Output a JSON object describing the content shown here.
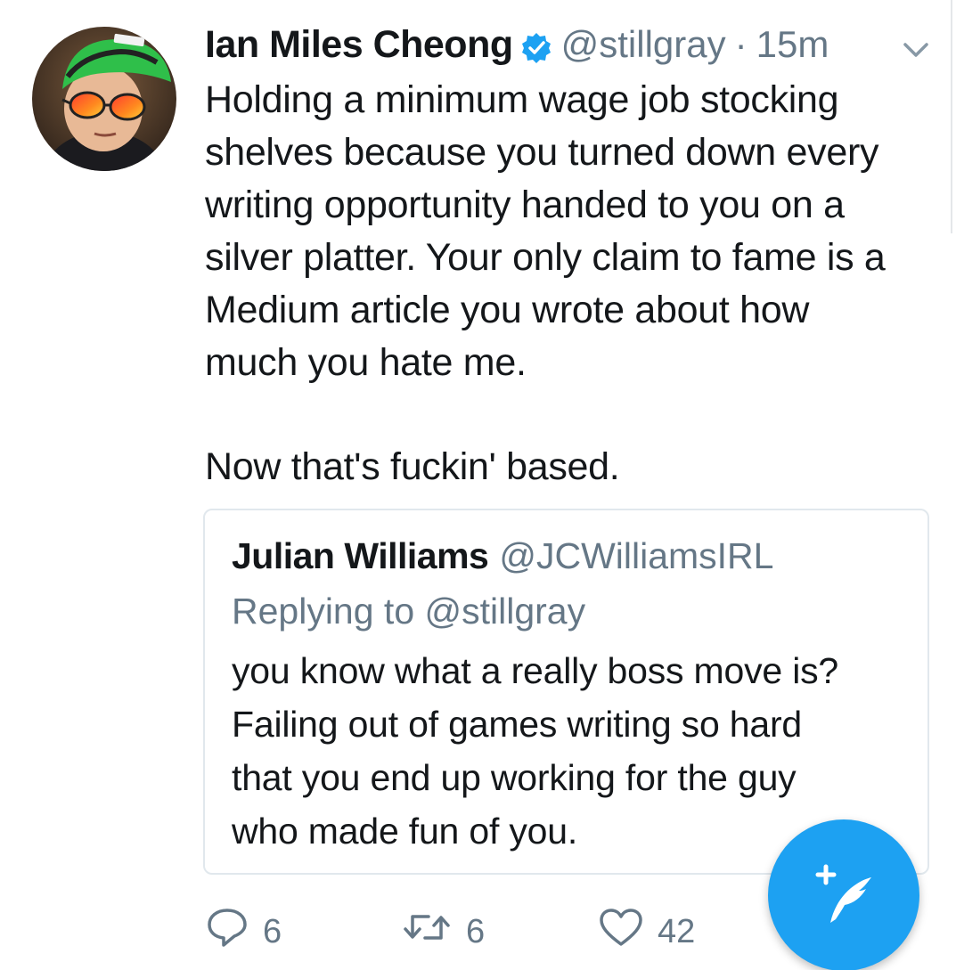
{
  "tweet": {
    "author_name": "Ian Miles Cheong",
    "author_handle": "@stillgray",
    "separator": "·",
    "time": "15m",
    "verified": true,
    "text_main": "Holding a minimum wage job stocking\nshelves because you turned down every\nwriting opportunity handed to you on a\nsilver platter. Your only claim to fame is a\nMedium article you wrote about how\nmuch you hate me.",
    "text_closing": "Now that's fuckin' based.",
    "quoted": {
      "author_name": "Julian Williams",
      "author_handle": "@JCWilliamsIRL",
      "replying_to": "Replying to @stillgray",
      "text": "you know what a really boss move is?\nFailing out of games writing so hard\nthat you end up working for the guy\nwho made fun of you."
    },
    "actions": {
      "reply_count": "6",
      "retweet_count": "6",
      "like_count": "42"
    }
  },
  "icons": {
    "verified": "verified-badge-icon",
    "caret": "chevron-down-icon",
    "reply": "reply-bubble-icon",
    "retweet": "retweet-icon",
    "like": "heart-icon",
    "compose": "compose-tweet-icon"
  },
  "colors": {
    "accent": "#1da1f2",
    "text": "#14171a",
    "muted": "#657786",
    "border": "#e1e8ed"
  }
}
